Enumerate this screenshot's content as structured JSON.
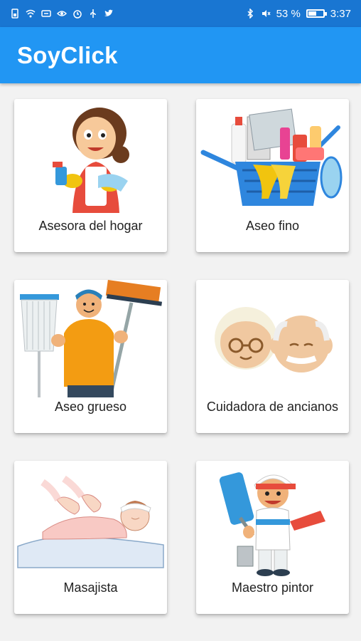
{
  "status_bar": {
    "left_icons": [
      "sim-icon",
      "wifi-icon",
      "nfc-icon",
      "eye-icon",
      "alarm-icon",
      "usb-icon",
      "twitter-icon"
    ],
    "right_icons": [
      "bluetooth-icon",
      "mute-icon",
      "battery-icon"
    ],
    "battery_percent": "53 %",
    "battery_level": 0.53,
    "time": "3:37"
  },
  "app_bar": {
    "title": "SoyClick",
    "color": "#2196f3"
  },
  "services": [
    {
      "label": "Asesora del hogar",
      "icon": "housekeeper-illustration"
    },
    {
      "label": "Aseo fino",
      "icon": "cleaning-supplies-illustration"
    },
    {
      "label": "Aseo grueso",
      "icon": "janitor-mop-illustration"
    },
    {
      "label": "Cuidadora de ancianos",
      "icon": "elderly-couple-illustration"
    },
    {
      "label": "Masajista",
      "icon": "massage-illustration"
    },
    {
      "label": "Maestro pintor",
      "icon": "painter-illustration"
    }
  ]
}
